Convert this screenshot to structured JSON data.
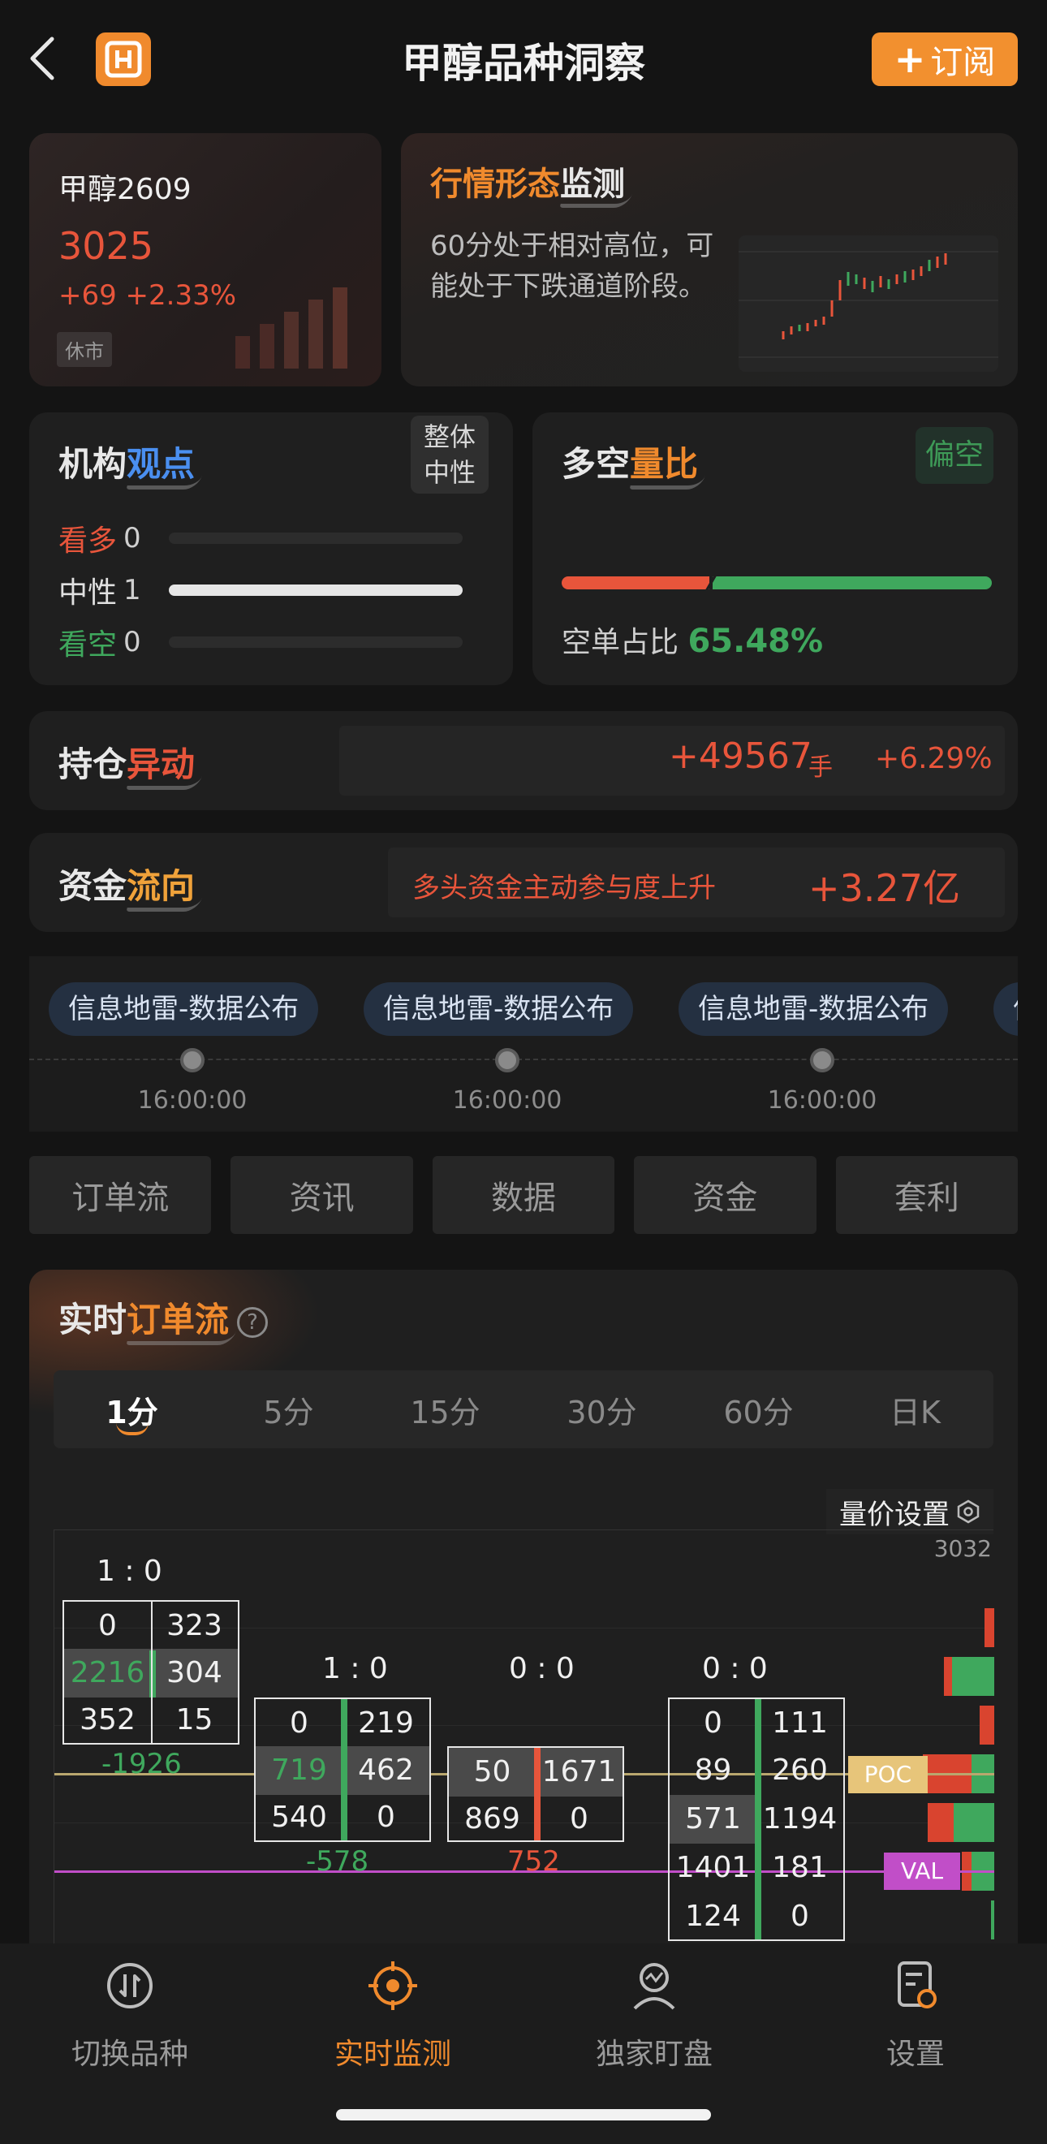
{
  "header": {
    "title": "甲醇品种洞察",
    "subscribe_label": "订阅",
    "subscribe_plus": "+"
  },
  "quote": {
    "name": "甲醇2609",
    "price": "3025",
    "change": "+69 +2.33%",
    "status": "休市"
  },
  "pattern": {
    "title_a": "行情形态",
    "title_b": "监测",
    "text": "60分处于相对高位，可能处于下跌通道阶段。"
  },
  "institution": {
    "title_a": "机构",
    "title_b": "观点",
    "badge": "整体中性",
    "rows": [
      {
        "label": "看多",
        "count": "0",
        "fill": 0
      },
      {
        "label": "中性",
        "count": "1",
        "fill": 1
      },
      {
        "label": "看空",
        "count": "0",
        "fill": 0
      }
    ]
  },
  "ratio": {
    "title_a": "多空",
    "title_b": "量比",
    "badge": "偏空",
    "label": "空单占比",
    "value": "65.48%",
    "short_share": 0.6548
  },
  "position": {
    "title_a": "持仓",
    "title_b": "异动",
    "value": "+49567",
    "unit": "手",
    "pct": "+6.29%"
  },
  "fund": {
    "title_a": "资金",
    "title_b": "流向",
    "note": "多头资金主动参与度上升",
    "value": "+3.27亿"
  },
  "timeline": [
    {
      "label": "信息地雷-数据公布",
      "time": "16:00:00"
    },
    {
      "label": "信息地雷-数据公布",
      "time": "16:00:00"
    },
    {
      "label": "信息地雷-数据公布",
      "time": "16:00:00"
    },
    {
      "label": "信",
      "time": ""
    }
  ],
  "tabs": [
    "订单流",
    "资讯",
    "数据",
    "资金",
    "套利"
  ],
  "orderflow": {
    "title_a": "实时",
    "title_b": "订单流",
    "help": "?",
    "periods": [
      "1分",
      "5分",
      "15分",
      "30分",
      "60分",
      "日K"
    ],
    "active_period": "1分",
    "setting_label": "量价设置",
    "price_tick": "3032",
    "poc_label": "POC",
    "val_label": "VAL",
    "bars": [
      {
        "ratio": "1  :  0",
        "rows": [
          [
            "0",
            "323"
          ],
          [
            "2216",
            "304"
          ],
          [
            "352",
            "15"
          ]
        ],
        "delta": "-1926"
      },
      {
        "ratio": "1  :  0",
        "rows": [
          [
            "0",
            "219"
          ],
          [
            "719",
            "462"
          ],
          [
            "540",
            "0"
          ]
        ],
        "delta": "-578"
      },
      {
        "ratio": "0  :  0",
        "rows": [
          [
            "50",
            "1671"
          ],
          [
            "869",
            "0"
          ]
        ],
        "delta": "752"
      },
      {
        "ratio": "0  :  0",
        "rows": [
          [
            "0",
            "111"
          ],
          [
            "89",
            "260"
          ],
          [
            "571",
            "1194"
          ],
          [
            "1401",
            "181"
          ],
          [
            "124",
            "0"
          ]
        ],
        "delta": ""
      }
    ]
  },
  "nav": {
    "items": [
      "切换品种",
      "实时监测",
      "独家盯盘",
      "设置"
    ],
    "active": "实时监测"
  },
  "colors": {
    "accent": "#f08a2d",
    "up": "#e8553b",
    "down": "#3fa85d"
  }
}
